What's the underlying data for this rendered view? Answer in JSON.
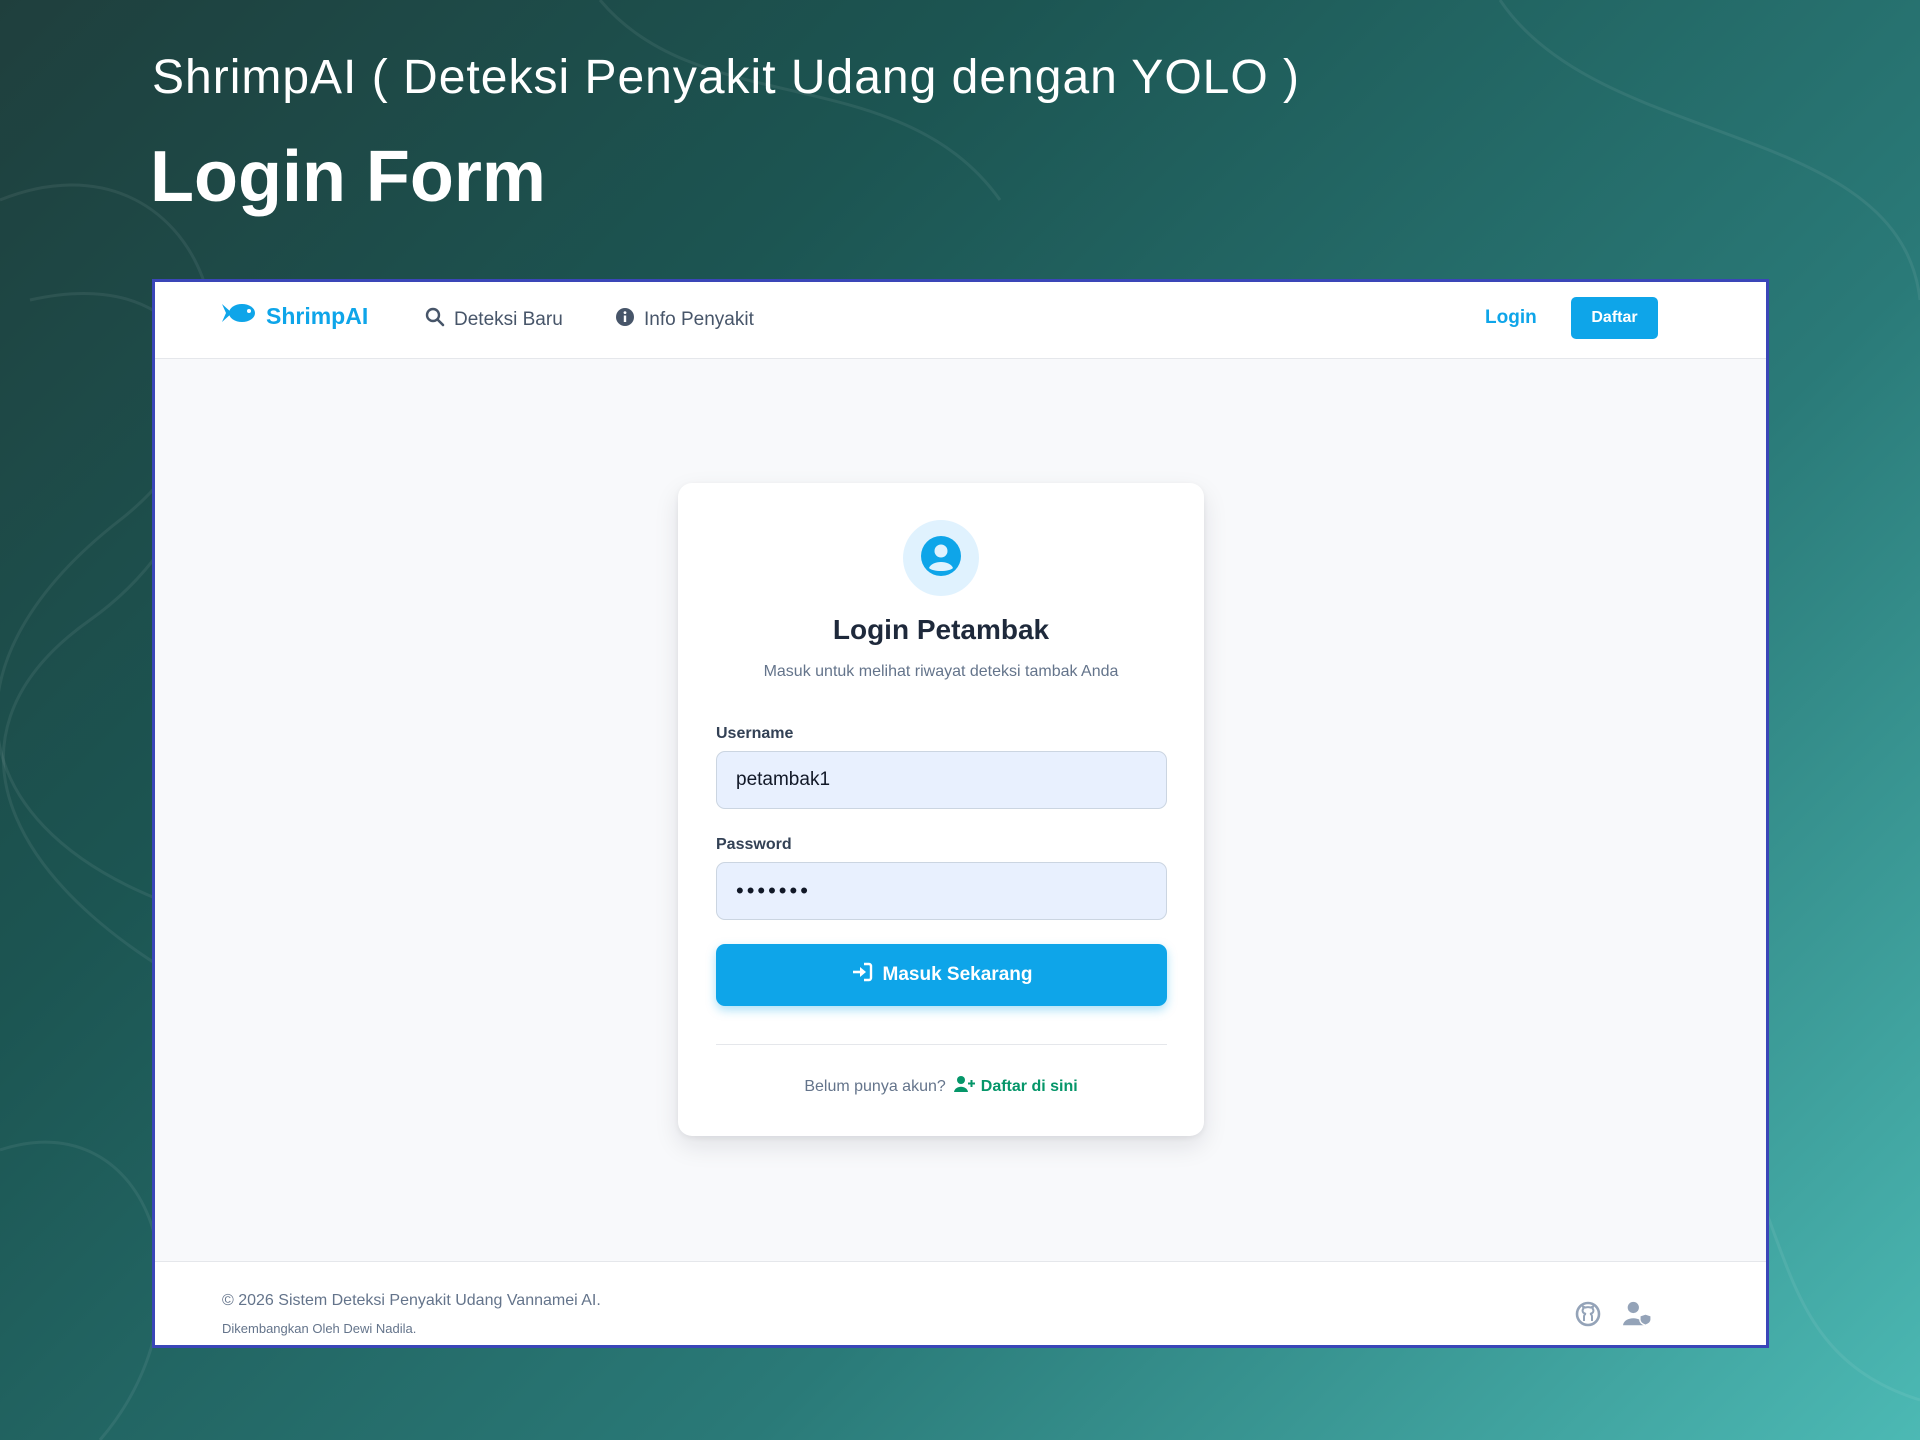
{
  "slide": {
    "subtitle": "ShrimpAI ( Deteksi Penyakit Udang dengan YOLO )",
    "title": "Login Form"
  },
  "navbar": {
    "brand": "ShrimpAI",
    "brand_icon": "fish-icon",
    "links": [
      {
        "label": "Deteksi Baru",
        "icon": "search-icon"
      },
      {
        "label": "Info Penyakit",
        "icon": "info-circle-icon"
      }
    ],
    "login_label": "Login",
    "register_label": "Daftar"
  },
  "login_card": {
    "icon": "user-circle-icon",
    "title": "Login Petambak",
    "subtitle": "Masuk untuk melihat riwayat deteksi tambak Anda",
    "username_label": "Username",
    "username_value": "petambak1",
    "password_label": "Password",
    "password_value": "•••••••",
    "submit_label": "Masuk Sekarang",
    "submit_icon": "sign-in-icon",
    "no_account_text": "Belum punya akun?",
    "register_link": "Daftar di sini",
    "register_icon": "user-plus-icon"
  },
  "footer": {
    "copyright": "© 2026 Sistem Deteksi Penyakit Udang Vannamei AI.",
    "developer": "Dikembangkan Oleh Dewi Nadila.",
    "icons": [
      "github-icon",
      "user-shield-icon"
    ]
  },
  "colors": {
    "primary": "#0ea5e9",
    "success": "#059669",
    "frame_border": "#3a46b8",
    "input_bg": "#e8f0fe"
  }
}
